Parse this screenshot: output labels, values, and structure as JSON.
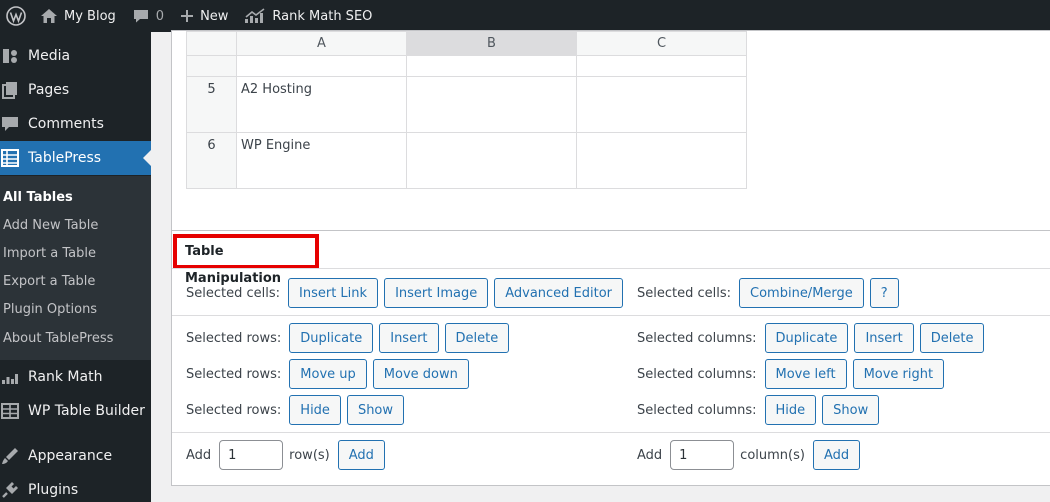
{
  "adminbar": {
    "site_name": "My Blog",
    "comments_count": "0",
    "new_label": "New",
    "seo_label": "Rank Math SEO"
  },
  "sidebar": {
    "items": [
      {
        "label": "Media",
        "icon": "media-icon"
      },
      {
        "label": "Pages",
        "icon": "pages-icon"
      },
      {
        "label": "Comments",
        "icon": "comments-icon"
      },
      {
        "label": "TablePress",
        "icon": "tablepress-icon"
      },
      {
        "label": "Rank Math",
        "icon": "rank-math-icon"
      },
      {
        "label": "WP Table Builder",
        "icon": "table-builder-icon"
      },
      {
        "label": "Appearance",
        "icon": "appearance-icon"
      },
      {
        "label": "Plugins",
        "icon": "plugins-icon"
      }
    ],
    "submenu": [
      "All Tables",
      "Add New Table",
      "Import a Table",
      "Export a Table",
      "Plugin Options",
      "About TablePress"
    ]
  },
  "grid": {
    "columns": [
      "A",
      "B",
      "C"
    ],
    "rows": [
      {
        "num": "5",
        "cells": [
          "A2 Hosting",
          "",
          ""
        ]
      },
      {
        "num": "6",
        "cells": [
          "WP Engine",
          "",
          ""
        ]
      }
    ]
  },
  "manipulation": {
    "title": "Table Manipulation",
    "selected_cells": "Selected cells:",
    "selected_rows": "Selected rows:",
    "selected_columns": "Selected columns:",
    "insert_link": "Insert Link",
    "insert_image": "Insert Image",
    "advanced_editor": "Advanced Editor",
    "combine_merge": "Combine/Merge",
    "help": "?",
    "duplicate": "Duplicate",
    "insert": "Insert",
    "delete": "Delete",
    "move_up": "Move up",
    "move_down": "Move down",
    "move_left": "Move left",
    "move_right": "Move right",
    "hide": "Hide",
    "show": "Show",
    "add": "Add",
    "rows_value": "1",
    "rows_unit": "row(s)",
    "columns_value": "1",
    "columns_unit": "column(s)"
  }
}
